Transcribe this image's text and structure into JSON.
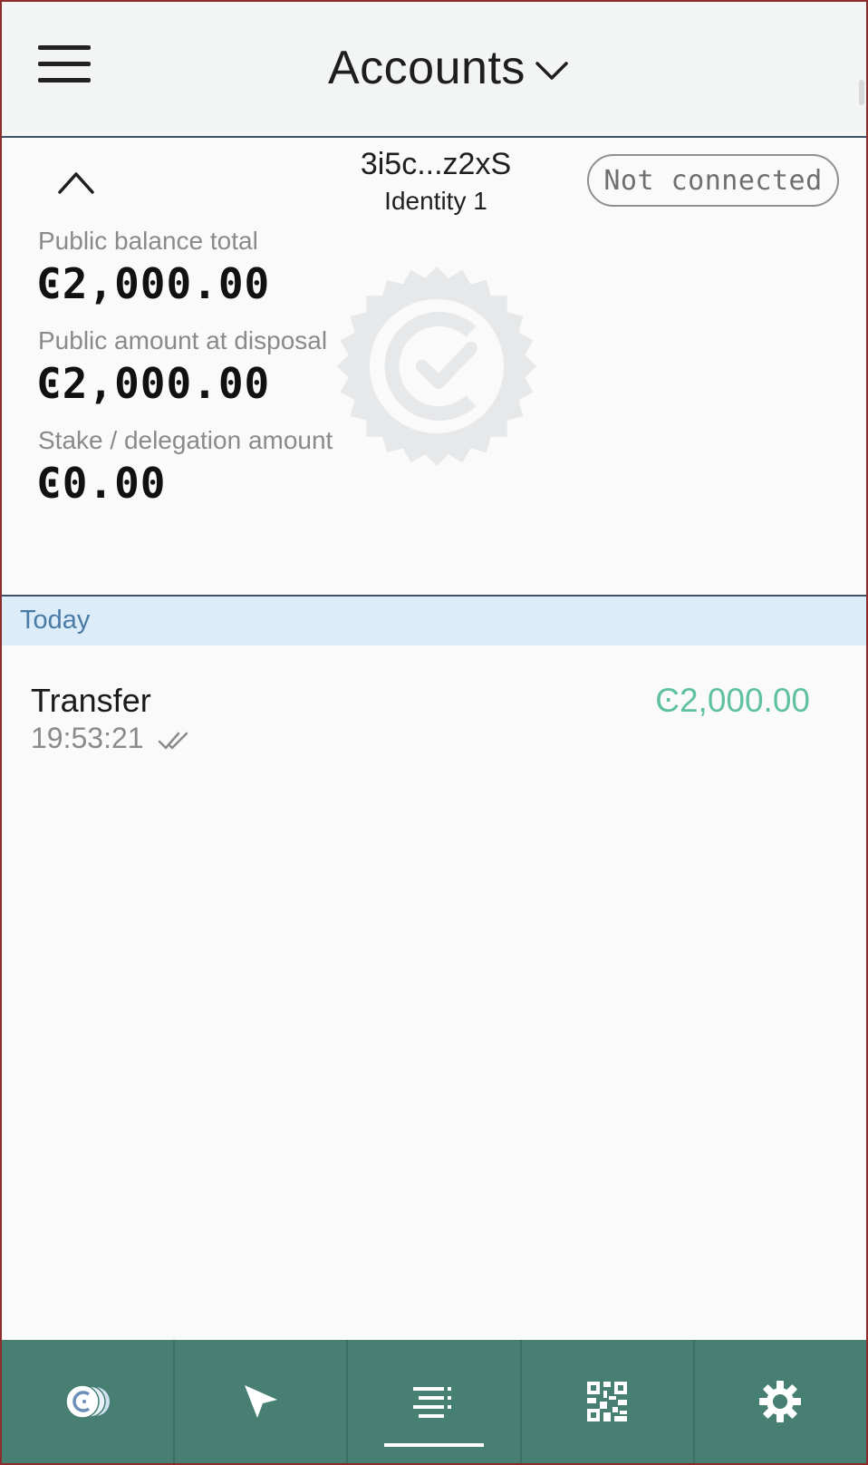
{
  "header": {
    "title": "Accounts",
    "menu_icon": "hamburger-menu-icon",
    "dropdown_icon": "chevron-down-icon"
  },
  "account": {
    "address": "3i5c...z2xS",
    "identity": "Identity 1",
    "status": "Not connected",
    "collapse_icon": "chevron-up-icon",
    "watermark_icon": "ccd-verified-seal-icon",
    "balances": [
      {
        "label": "Public balance total",
        "value": "Ͼ2,000.00"
      },
      {
        "label": "Public amount at disposal",
        "value": "Ͼ2,000.00"
      },
      {
        "label": "Stake / delegation amount",
        "value": "Ͼ0.00"
      }
    ]
  },
  "transactions": {
    "group_label": "Today",
    "items": [
      {
        "type": "Transfer",
        "time": "19:53:21",
        "amount": "Ͼ2,000.00",
        "status_icon": "double-check-icon"
      }
    ]
  },
  "bottom_nav": {
    "items": [
      {
        "name": "accounts",
        "icon": "ccd-coins-icon",
        "active": false
      },
      {
        "name": "send",
        "icon": "send-arrow-icon",
        "active": false
      },
      {
        "name": "transactions",
        "icon": "transaction-list-icon",
        "active": true
      },
      {
        "name": "qr",
        "icon": "qr-code-icon",
        "active": false
      },
      {
        "name": "settings",
        "icon": "gear-icon",
        "active": false
      }
    ]
  },
  "colors": {
    "header_bg": "#f3f4f4",
    "divider": "#3d5267",
    "day_header_bg": "#dcecf8",
    "day_header_text": "#4a7aa6",
    "amount_positive": "#5fc1a0",
    "nav_bg": "#477f73",
    "window_frame": "#8b2d2d"
  }
}
